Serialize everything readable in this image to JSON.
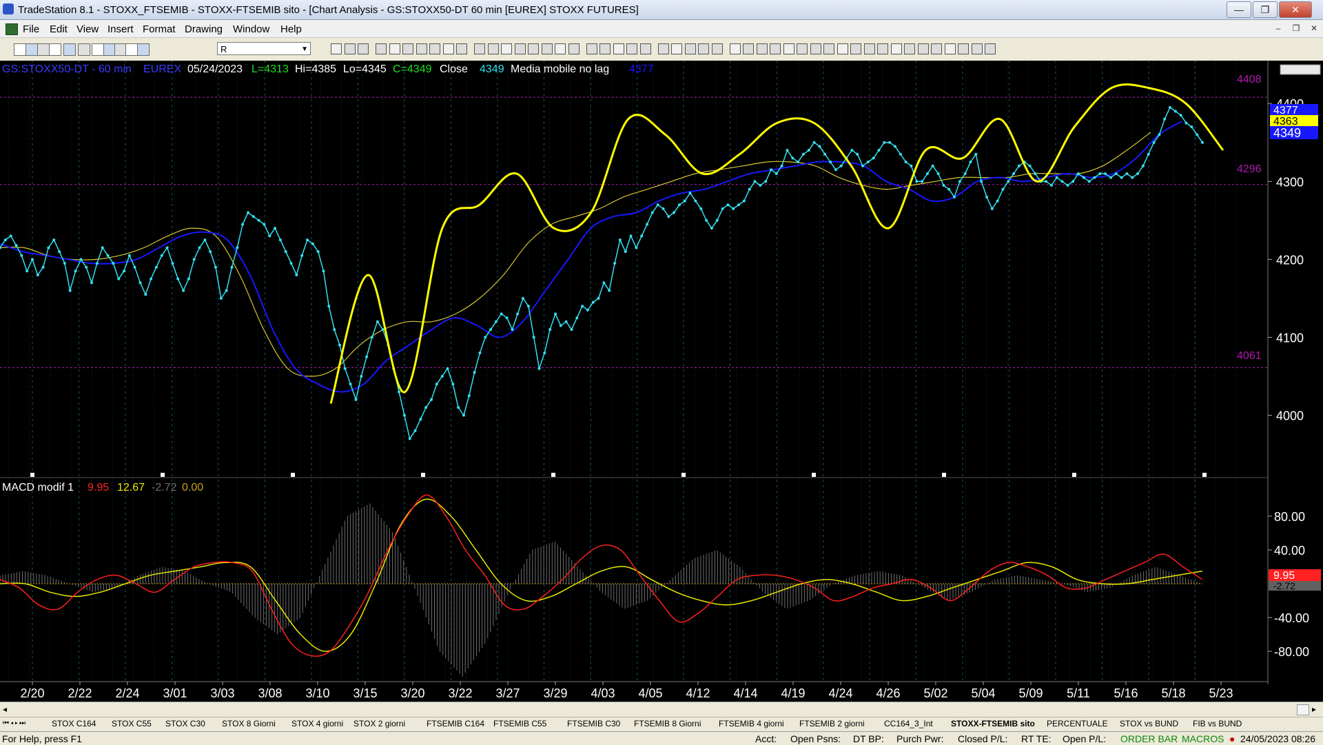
{
  "window": {
    "title": "TradeStation 8.1 - STOXX_FTSEMIB - STOXX-FTSEMIB sito - [Chart Analysis - GS:STOXX50-DT  60 min  [EUREX] STOXX FUTURES]",
    "minimize": "—",
    "maximize": "❐",
    "close": "✕"
  },
  "menu": {
    "items": [
      "File",
      "Edit",
      "View",
      "Insert",
      "Format",
      "Drawing",
      "Window",
      "Help"
    ],
    "mdi_min": "–",
    "mdi_restore": "❐",
    "mdi_close": "✕"
  },
  "toolbar": {
    "symbol_combo": "R"
  },
  "header": {
    "symbol": "GS:STOXX50-DT - 60 min",
    "exchange": "EUREX",
    "date": "05/24/2023",
    "last": "L=4313",
    "high": "Hi=4385",
    "low": "Lo=4345",
    "close": "C=4349",
    "close_label": "Close",
    "close_value": "4349",
    "indicator_name": "Media mobile no lag",
    "indicator_value": "4377"
  },
  "macd_header": {
    "name": "MACD modif 1",
    "v1": "9.95",
    "v2": "12.67",
    "v3": "-2.72",
    "v4": "0.00"
  },
  "price_right_labels": {
    "level_top": "4408",
    "level_mid": "4296",
    "level_low": "4061",
    "badge_blue": "4377",
    "badge_yellow": "4363",
    "badge_close": "4349"
  },
  "macd_right_labels": {
    "badge_red": "9.95",
    "badge_gray": "-2.72"
  },
  "colors": {
    "background": "#000000",
    "price": "#33e0f0",
    "ma_blue": "#1818ff",
    "ma_thin": "#d8c830",
    "cycle": "#ffff00",
    "macd_red": "#ff2020",
    "macd_yellow": "#e8e800",
    "hist": "#707070",
    "level": "#b01cb0"
  },
  "chart_data": [
    {
      "type": "line",
      "title": "GS:STOXX50-DT - 60 min",
      "x_ticks": [
        "2/20",
        "2/22",
        "2/24",
        "3/01",
        "3/03",
        "3/08",
        "3/10",
        "3/15",
        "3/20",
        "3/22",
        "3/27",
        "3/29",
        "4/03",
        "4/05",
        "4/12",
        "4/14",
        "4/19",
        "4/24",
        "4/26",
        "5/02",
        "5/04",
        "5/09",
        "5/11",
        "5/16",
        "5/18",
        "5/23"
      ],
      "y_ticks": [
        4000,
        4100,
        4200,
        4300,
        4400
      ],
      "ylim": [
        3920,
        4455
      ],
      "levels": [
        4408,
        4296,
        4061
      ],
      "series": [
        {
          "name": "Close",
          "values": [
            4215,
            4225,
            4230,
            4218,
            4205,
            4185,
            4200,
            4180,
            4190,
            4215,
            4225,
            4210,
            4195,
            4160,
            4185,
            4200,
            4190,
            4170,
            4195,
            4215,
            4205,
            4195,
            4175,
            4185,
            4205,
            4190,
            4170,
            4155,
            4175,
            4190,
            4205,
            4215,
            4195,
            4175,
            4160,
            4175,
            4200,
            4215,
            4225,
            4210,
            4190,
            4150,
            4160,
            4190,
            4215,
            4245,
            4260,
            4255,
            4250,
            4245,
            4230,
            4240,
            4225,
            4210,
            4195,
            4180,
            4205,
            4225,
            4220,
            4210,
            4185,
            4140,
            4110,
            4090,
            4060,
            4040,
            4020,
            4050,
            4075,
            4100,
            4120,
            4110,
            4090,
            4060,
            4030,
            4000,
            3970,
            3980,
            3995,
            4010,
            4020,
            4040,
            4050,
            4060,
            4040,
            4010,
            4000,
            4025,
            4055,
            4080,
            4100,
            4110,
            4120,
            4130,
            4125,
            4110,
            4130,
            4150,
            4140,
            4100,
            4060,
            4080,
            4110,
            4130,
            4115,
            4120,
            4110,
            4125,
            4140,
            4135,
            4145,
            4150,
            4170,
            4160,
            4195,
            4225,
            4210,
            4230,
            4215,
            4230,
            4245,
            4260,
            4270,
            4265,
            4255,
            4260,
            4270,
            4275,
            4285,
            4275,
            4265,
            4250,
            4240,
            4250,
            4265,
            4270,
            4265,
            4270,
            4275,
            4290,
            4300,
            4295,
            4300,
            4315,
            4310,
            4320,
            4340,
            4330,
            4325,
            4335,
            4340,
            4350,
            4345,
            4335,
            4325,
            4315,
            4320,
            4330,
            4340,
            4335,
            4320,
            4325,
            4330,
            4340,
            4350,
            4350,
            4345,
            4335,
            4325,
            4320,
            4300,
            4300,
            4310,
            4320,
            4310,
            4295,
            4290,
            4280,
            4300,
            4310,
            4325,
            4335,
            4300,
            4280,
            4265,
            4275,
            4290,
            4300,
            4310,
            4320,
            4325,
            4320,
            4310,
            4300,
            4300,
            4295,
            4305,
            4300,
            4295,
            4300,
            4310,
            4305,
            4300,
            4305,
            4310,
            4310,
            4305,
            4310,
            4305,
            4310,
            4305,
            4310,
            4320,
            4335,
            4350,
            4360,
            4380,
            4395,
            4390,
            4385,
            4375,
            4370,
            4360,
            4350
          ]
        },
        {
          "name": "Media mobile no lag",
          "values": [
            4220,
            4210,
            4205,
            4200,
            4195,
            4195,
            4200,
            4215,
            4230,
            4235,
            4225,
            4180,
            4110,
            4060,
            4040,
            4030,
            4040,
            4070,
            4090,
            4110,
            4125,
            4115,
            4100,
            4120,
            4160,
            4200,
            4240,
            4255,
            4260,
            4275,
            4285,
            4290,
            4300,
            4310,
            4315,
            4320,
            4325,
            4325,
            4320,
            4300,
            4290,
            4275,
            4280,
            4300,
            4305,
            4300,
            4305,
            4310,
            4305,
            4310,
            4330,
            4360,
            4377
          ]
        },
        {
          "name": "MA thin",
          "values": [
            4215,
            4215,
            4205,
            4200,
            4200,
            4205,
            4215,
            4230,
            4240,
            4230,
            4180,
            4110,
            4060,
            4050,
            4060,
            4090,
            4110,
            4120,
            4120,
            4130,
            4150,
            4180,
            4220,
            4245,
            4255,
            4265,
            4280,
            4290,
            4300,
            4310,
            4315,
            4320,
            4325,
            4325,
            4320,
            4305,
            4295,
            4290,
            4295,
            4300,
            4305,
            4305,
            4305,
            4310,
            4310,
            4310,
            4320,
            4340,
            4363
          ]
        },
        {
          "name": "Cycle",
          "values": [
            4015,
            4180,
            4030,
            4240,
            4270,
            4310,
            4240,
            4260,
            4380,
            4360,
            4310,
            4335,
            4375,
            4375,
            4320,
            4240,
            4340,
            4330,
            4380,
            4300,
            4370,
            4420,
            4420,
            4400,
            4340
          ]
        }
      ]
    },
    {
      "type": "line",
      "title": "MACD modif 1",
      "y_ticks": [
        80,
        40,
        -40,
        -80
      ],
      "ylim": [
        -115,
        110
      ],
      "series": [
        {
          "name": "MACD",
          "values": [
            5,
            -5,
            -25,
            -30,
            -10,
            5,
            10,
            0,
            -10,
            5,
            20,
            25,
            25,
            15,
            -30,
            -70,
            -85,
            -80,
            -50,
            -10,
            40,
            80,
            105,
            80,
            40,
            10,
            -25,
            -30,
            -15,
            5,
            30,
            45,
            40,
            10,
            -20,
            -45,
            -35,
            -15,
            5,
            10,
            10,
            5,
            -5,
            -20,
            -15,
            -5,
            0,
            5,
            -5,
            -20,
            -5,
            15,
            25,
            20,
            10,
            -5,
            -5,
            5,
            15,
            25,
            35,
            20,
            5
          ]
        },
        {
          "name": "Signal",
          "values": [
            0,
            0,
            -10,
            -15,
            -10,
            0,
            10,
            15,
            20,
            25,
            20,
            -20,
            -60,
            -80,
            -60,
            0,
            70,
            100,
            80,
            40,
            0,
            -20,
            -15,
            0,
            15,
            20,
            5,
            -10,
            -20,
            -25,
            -20,
            -10,
            0,
            5,
            0,
            -10,
            -20,
            -15,
            -5,
            5,
            15,
            25,
            20,
            5,
            0,
            0,
            5,
            10,
            15
          ]
        },
        {
          "name": "Histogram",
          "values": [
            10,
            15,
            10,
            0,
            -10,
            -5,
            10,
            20,
            15,
            0,
            -10,
            -40,
            -60,
            -40,
            20,
            80,
            95,
            60,
            -10,
            -80,
            -110,
            -70,
            -10,
            40,
            50,
            20,
            -10,
            -30,
            -20,
            5,
            30,
            40,
            20,
            -10,
            -30,
            -20,
            0,
            10,
            15,
            10,
            -5,
            -20,
            -10,
            5,
            10,
            5,
            0,
            -10,
            -5,
            10,
            20,
            10,
            0
          ]
        }
      ]
    }
  ],
  "tabs": [
    "STOX C164",
    "STOX C55",
    "STOX  C30",
    "STOX  8 Giorni",
    "STOX 4 giorni",
    "STOX  2 giorni",
    "FTSEMIB C164",
    "FTSEMIB C55",
    "FTSEMIB C30",
    "FTSEMIB  8 Giorni",
    "FTSEMIB  4 giorni",
    "FTSEMIB  2 giorni",
    "CC164_3_Int",
    "STOXX-FTSEMIB sito",
    "PERCENTUALE",
    "STOX vs BUND",
    "FIB vs BUND"
  ],
  "status": {
    "help": "For Help, press F1",
    "acct": "Acct:",
    "open_psns": "Open Psns:",
    "dt_bp": "DT BP:",
    "purch_pwr": "Purch Pwr:",
    "closed_pl": "Closed P/L:",
    "rt_te": "RT TE:",
    "open_pl": "Open P/L:",
    "order_bar": "ORDER BAR",
    "macros": "MACROS",
    "datetime": "24/05/2023 08:26"
  }
}
